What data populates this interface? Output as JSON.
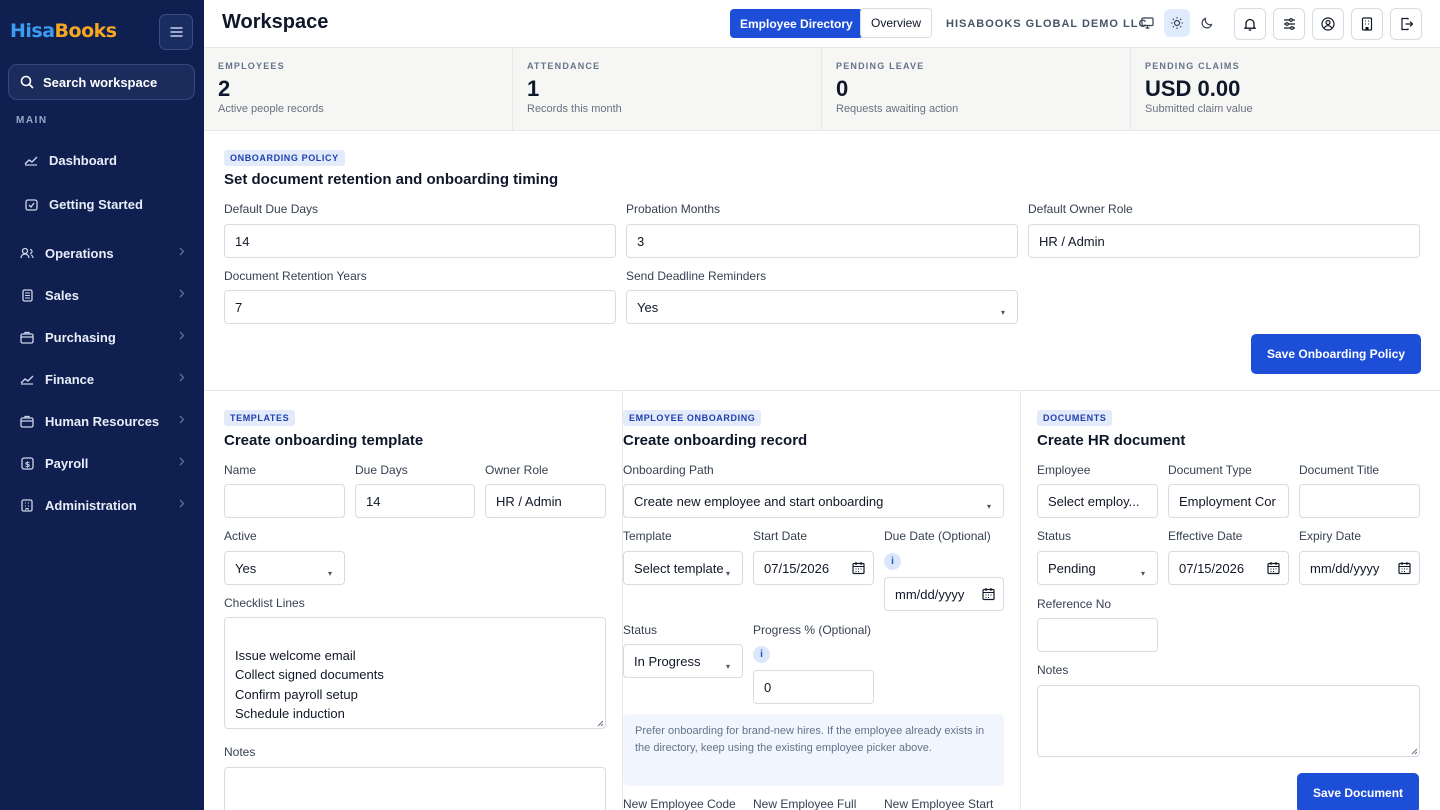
{
  "app": {
    "logo_part1": "Hisa",
    "logo_part2": "Books",
    "search_placeholder": "Search workspace",
    "section_main": "MAIN"
  },
  "sidebar": {
    "items": [
      {
        "label": "Dashboard",
        "icon": "chart-line-icon"
      },
      {
        "label": "Getting Started",
        "icon": "checklist-icon"
      },
      {
        "label": "Operations",
        "icon": "users-icon"
      },
      {
        "label": "Sales",
        "icon": "receipt-icon"
      },
      {
        "label": "Purchasing",
        "icon": "shopping-bag-icon"
      },
      {
        "label": "Finance",
        "icon": "chart-line-icon"
      },
      {
        "label": "Human Resources",
        "icon": "briefcase-icon"
      },
      {
        "label": "Payroll",
        "icon": "dollar-icon"
      },
      {
        "label": "Administration",
        "icon": "building-icon"
      }
    ]
  },
  "header": {
    "title": "Workspace",
    "employee_directory": "Employee Directory",
    "overview": "Overview",
    "company": "HISABOOKS GLOBAL DEMO LLC"
  },
  "stats": [
    {
      "label": "EMPLOYEES",
      "value": "2",
      "sub": "Active people records"
    },
    {
      "label": "ATTENDANCE",
      "value": "1",
      "sub": "Records this month"
    },
    {
      "label": "PENDING LEAVE",
      "value": "0",
      "sub": "Requests awaiting action"
    },
    {
      "label": "PENDING CLAIMS",
      "value": "USD 0.00",
      "sub": "Submitted claim value"
    }
  ],
  "policy": {
    "badge": "ONBOARDING POLICY",
    "title": "Set document retention and onboarding timing",
    "due_days_label": "Default Due Days",
    "due_days_value": "14",
    "probation_label": "Probation Months",
    "probation_value": "3",
    "owner_label": "Default Owner Role",
    "owner_value": "HR / Admin",
    "retention_label": "Document Retention Years",
    "retention_value": "7",
    "reminders_label": "Send Deadline Reminders",
    "reminders_value": "Yes",
    "save_label": "Save Onboarding Policy"
  },
  "templates": {
    "badge": "TEMPLATES",
    "title": "Create onboarding template",
    "name_label": "Name",
    "name_value": "",
    "due_days_label": "Due Days",
    "due_days_value": "14",
    "owner_label": "Owner Role",
    "owner_value": "HR / Admin",
    "active_label": "Active",
    "active_value": "Yes",
    "checklist_label": "Checklist Lines",
    "checklist_value": "Issue welcome email\nCollect signed documents\nConfirm payroll setup\nSchedule induction",
    "notes_label": "Notes"
  },
  "onboarding": {
    "badge": "EMPLOYEE ONBOARDING",
    "title": "Create onboarding record",
    "path_label": "Onboarding Path",
    "path_value": "Create new employee and start onboarding",
    "template_label": "Template",
    "template_value": "Select template",
    "start_label": "Start Date",
    "start_value": "07/15/2026",
    "due_label": "Due Date (Optional)",
    "due_value": "mm/dd/yyyy",
    "status_label": "Status",
    "status_value": "In Progress",
    "progress_label": "Progress % (Optional)",
    "progress_value": "0",
    "hint": "Prefer onboarding for brand-new hires. If the employee already exists in the directory, keep using the existing employee picker above.",
    "new_code_label": "New Employee Code",
    "new_full_label": "New Employee Full",
    "new_start_label": "New Employee Start"
  },
  "documents": {
    "badge": "DOCUMENTS",
    "title": "Create HR document",
    "employee_label": "Employee",
    "employee_value": "Select employ...",
    "type_label": "Document Type",
    "type_value": "Employment Cor",
    "doc_title_label": "Document Title",
    "status_label": "Status",
    "status_value": "Pending",
    "effective_label": "Effective Date",
    "effective_value": "07/15/2026",
    "expiry_label": "Expiry Date",
    "expiry_value": "mm/dd/yyyy",
    "ref_label": "Reference No",
    "notes_label": "Notes",
    "save_label": "Save Document"
  },
  "colors": {
    "sidebar_bg": "#0f2050",
    "primary": "#1d4ed8",
    "badge_bg": "#e3ebfb"
  }
}
